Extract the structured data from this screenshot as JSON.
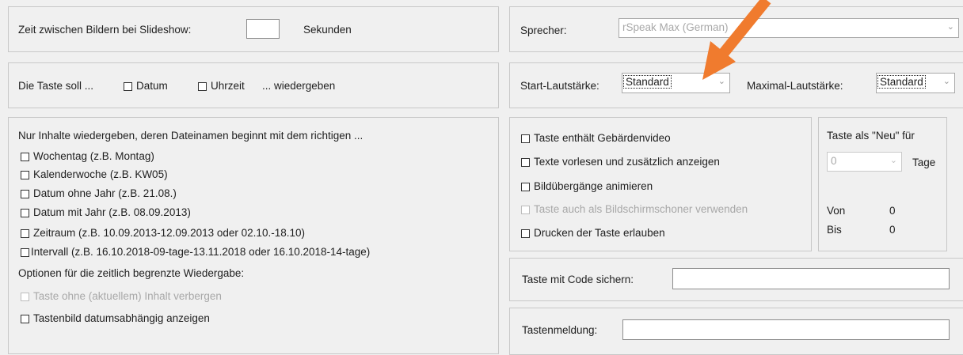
{
  "slideshow": {
    "label": "Zeit zwischen Bildern bei Slideshow:",
    "value": "",
    "unit": "Sekunden"
  },
  "speaker": {
    "label": "Sprecher:",
    "value": "rSpeak Max (German)"
  },
  "key_plays": {
    "prefix": "Die Taste soll ...",
    "date": "Datum",
    "time": "Uhrzeit",
    "suffix": "... wiedergeben"
  },
  "volume": {
    "start_label": "Start-Lautstärke:",
    "start_value": "Standard",
    "max_label": "Maximal-Lautstärke:",
    "max_value": "Standard"
  },
  "filename_filter": {
    "intro": "Nur Inhalte wiedergeben, deren Dateinamen beginnt mit dem richtigen ...",
    "options": [
      "Wochentag (z.B. Montag)",
      "Kalenderwoche (z.B. KW05)",
      "Datum ohne Jahr (z.B. 21.08.)",
      "Datum mit Jahr (z.B. 08.09.2013)",
      "Zeitraum (z.B. 10.09.2013-12.09.2013 oder 02.10.-18.10)",
      "Intervall (z.B. 16.10.2018-09-tage-13.11.2018 oder 16.10.2018-14-tage)"
    ],
    "limited_title": "Optionen für die zeitlich begrenzte Wiedergabe:",
    "hide_empty": "Taste ohne (aktuellem) Inhalt verbergen",
    "date_image": "Tastenbild datumsabhängig anzeigen"
  },
  "key_options": {
    "sign_video": "Taste enthält Gebärdenvideo",
    "read_texts": "Texte vorlesen und zusätzlich anzeigen",
    "animate": "Bildübergänge animieren",
    "screensaver": "Taste auch als Bildschirmschoner verwenden",
    "print": "Drucken der Taste erlauben"
  },
  "new_panel": {
    "title": "Taste als \"Neu\" für",
    "days_value": "0",
    "days_unit": "Tage",
    "from_label": "Von",
    "from_value": "0",
    "to_label": "Bis",
    "to_value": "0"
  },
  "code": {
    "label": "Taste mit Code sichern:",
    "value": ""
  },
  "message": {
    "label": "Tastenmeldung:",
    "value": ""
  },
  "colors": {
    "arrow": "#f07b2e",
    "background": "#f0f0f0"
  }
}
